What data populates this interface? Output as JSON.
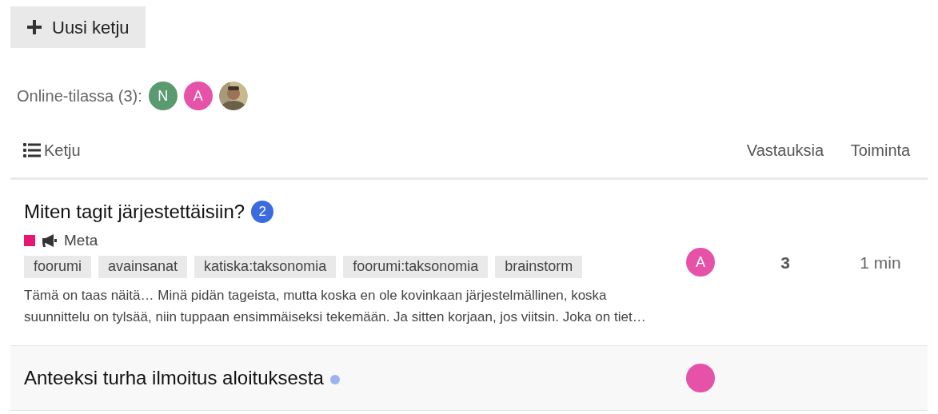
{
  "new_topic_button": {
    "label": "Uusi ketju"
  },
  "online": {
    "label": "Online-tilassa (3):",
    "users": [
      {
        "kind": "letter",
        "letter": "N",
        "color": "#5a9a6f"
      },
      {
        "kind": "letter",
        "letter": "A",
        "color": "#e552a8"
      },
      {
        "kind": "picture"
      }
    ]
  },
  "table": {
    "columns": [
      "Ketju",
      "Vastauksia",
      "Toiminta"
    ],
    "rows": [
      {
        "title": "Miten tagit järjestettäisiin?",
        "unread": "2",
        "new": false,
        "category": {
          "name": "Meta",
          "color": "#e5176f"
        },
        "tags": [
          "foorumi",
          "avainsanat",
          "katiska:taksonomia",
          "foorumi:taksonomia",
          "brainstorm"
        ],
        "excerpt": "Tämä on taas näitä… Minä pidän tageista, mutta koska en ole kovinkaan järjestelmällinen, koska suunnittelu on tylsää, niin tuppaan ensimmäiseksi tekemään. Ja sitten korjaan, jos viitsin. Joka on tiet…",
        "poster": {
          "letter": "A",
          "color": "#e552a8"
        },
        "replies": "3",
        "activity": "1 min",
        "highlighted": false
      },
      {
        "title": "Anteeksi turha ilmoitus aloituksesta",
        "new": true,
        "poster": {
          "color": "#e552a8"
        },
        "highlighted": true
      }
    ]
  }
}
